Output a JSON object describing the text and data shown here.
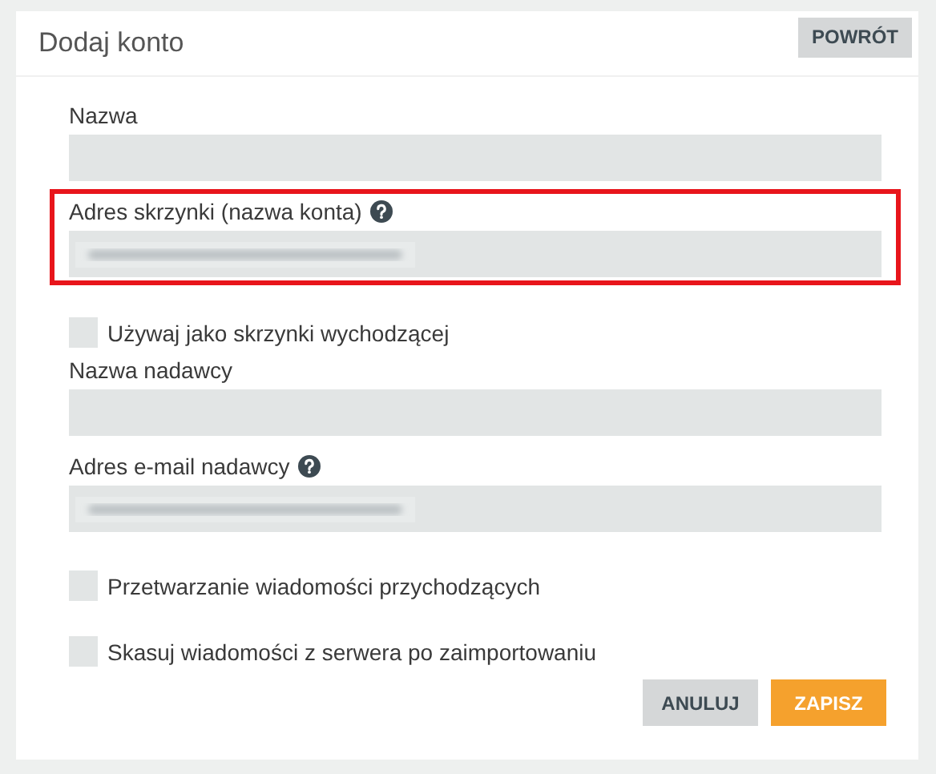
{
  "header": {
    "title": "Dodaj konto",
    "back_button": "POWRÓT"
  },
  "form": [
    {
      "kind": "text",
      "label": "Nazwa",
      "help": false,
      "redacted": false,
      "highlighted": false
    },
    {
      "kind": "text",
      "label": "Adres skrzynki (nazwa konta)",
      "help": true,
      "redacted": true,
      "highlighted": true
    },
    {
      "kind": "checkbox",
      "label": "Używaj jako skrzynki wychodzącej",
      "checked": false
    },
    {
      "kind": "text",
      "label": "Nazwa nadawcy",
      "help": false,
      "redacted": false,
      "highlighted": false
    },
    {
      "kind": "text",
      "label": "Adres e-mail nadawcy",
      "help": true,
      "redacted": true,
      "highlighted": false
    },
    {
      "kind": "checkbox",
      "label": "Przetwarzanie wiadomości przychodzących",
      "checked": false
    },
    {
      "kind": "checkbox",
      "label": "Skasuj wiadomości z serwera po zaimportowaniu",
      "checked": false
    }
  ],
  "buttons": [
    {
      "label": "ANULUJ",
      "kind": "secondary"
    },
    {
      "label": "ZAPISZ",
      "kind": "primary"
    }
  ]
}
